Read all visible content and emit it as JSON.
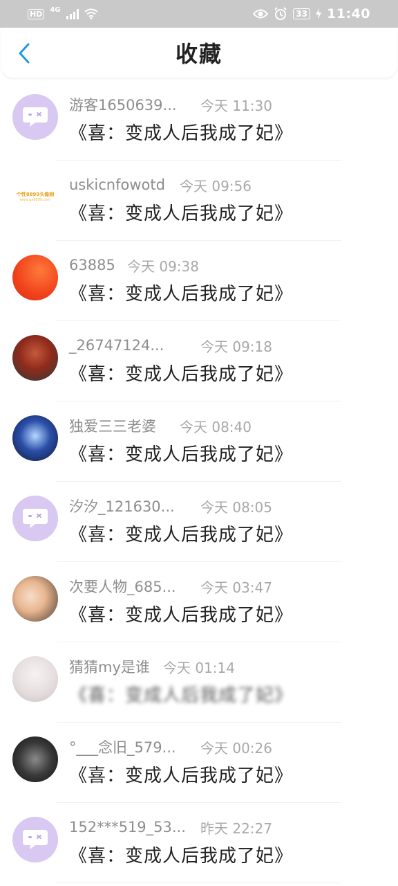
{
  "status_bar": {
    "hd": "HD",
    "network": "4G",
    "battery": "33",
    "time": "11:40"
  },
  "header": {
    "title": "收藏",
    "back_icon": "chevron-left-icon",
    "accent": "#2196e8"
  },
  "favorites": [
    {
      "user": "游客1650639...",
      "time": "今天 11:30",
      "title": "《喜：变成人后我成了妃》",
      "avatar": "default"
    },
    {
      "user": "uskicnfowotd",
      "time": "今天 09:56",
      "title": "《喜：变成人后我成了妃》",
      "avatar": "text",
      "avatar_text": "个性8899头像网",
      "avatar_subtext": "www.gx8899.com"
    },
    {
      "user": "63885",
      "time": "今天 09:38",
      "title": "《喜：变成人后我成了妃》",
      "avatar": "orange"
    },
    {
      "user": "_26747124...",
      "time": "今天 09:18",
      "title": "《喜：变成人后我成了妃》",
      "avatar": "anime1"
    },
    {
      "user": "独爱三三老婆",
      "time": "今天 08:40",
      "title": "《喜：变成人后我成了妃》",
      "avatar": "anime2"
    },
    {
      "user": "汐汐_121630...",
      "time": "今天 08:05",
      "title": "《喜：变成人后我成了妃》",
      "avatar": "default"
    },
    {
      "user": "次要人物_685...",
      "time": "今天 03:47",
      "title": "《喜：变成人后我成了妃》",
      "avatar": "anime3"
    },
    {
      "user": "猜猜my是谁",
      "time": "今天 01:14",
      "title": "《喜：变成人后我成了妃》",
      "avatar": "anime4",
      "blurred": true
    },
    {
      "user": "°___念旧_579...",
      "time": "今天 00:26",
      "title": "《喜：变成人后我成了妃》",
      "avatar": "anime5"
    },
    {
      "user": "152***519_53...",
      "time": "昨天 22:27",
      "title": "《喜：变成人后我成了妃》",
      "avatar": "default"
    }
  ]
}
